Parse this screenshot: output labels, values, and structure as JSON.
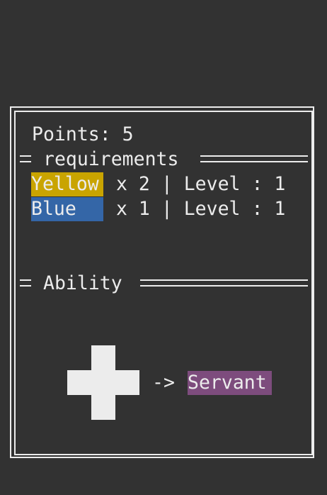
{
  "points": {
    "label": "Points: 5"
  },
  "requirements": {
    "header": "requirements",
    "items": [
      {
        "color_name": "Yellow",
        "color": "#c9a400",
        "detail": "x 2 | Level : 1"
      },
      {
        "color_name": "Blue",
        "color": "#3466a7",
        "detail": "x 1 | Level : 1"
      }
    ]
  },
  "ability": {
    "header": "Ability",
    "icon": "plus-cross-icon",
    "arrow": "->",
    "result": {
      "label": "Servant",
      "color": "#7d4c7d"
    }
  },
  "colors": {
    "background": "#323232",
    "foreground": "#ececec"
  }
}
